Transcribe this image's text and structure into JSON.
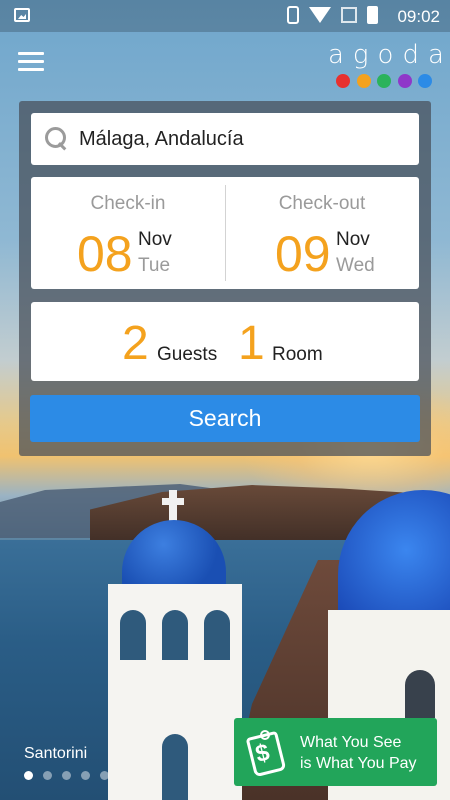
{
  "status_bar": {
    "time": "09:02",
    "icons": [
      "gallery-icon",
      "vibrate-icon",
      "wifi-icon",
      "no-signal-icon",
      "battery-icon"
    ]
  },
  "header": {
    "logo_text": "agoda",
    "logo_dot_colors": [
      "#e8312f",
      "#f4a21e",
      "#2bb35c",
      "#8f38c9",
      "#2c8be6"
    ]
  },
  "search": {
    "destination": "Málaga, Andalucía",
    "check_in": {
      "label": "Check-in",
      "day": "08",
      "month": "Nov",
      "weekday": "Tue"
    },
    "check_out": {
      "label": "Check-out",
      "day": "09",
      "month": "Nov",
      "weekday": "Wed"
    },
    "guests": {
      "count": "2",
      "label": "Guests"
    },
    "rooms": {
      "count": "1",
      "label": "Room"
    },
    "button_label": "Search"
  },
  "background": {
    "caption": "Santorini",
    "pager": {
      "total": 5,
      "active": 1
    }
  },
  "promo": {
    "line1": "What You See",
    "line2": "is What You Pay"
  },
  "colors": {
    "accent_orange": "#f4a21e",
    "search_blue": "#2c8be6",
    "promo_green": "#22a55a"
  }
}
